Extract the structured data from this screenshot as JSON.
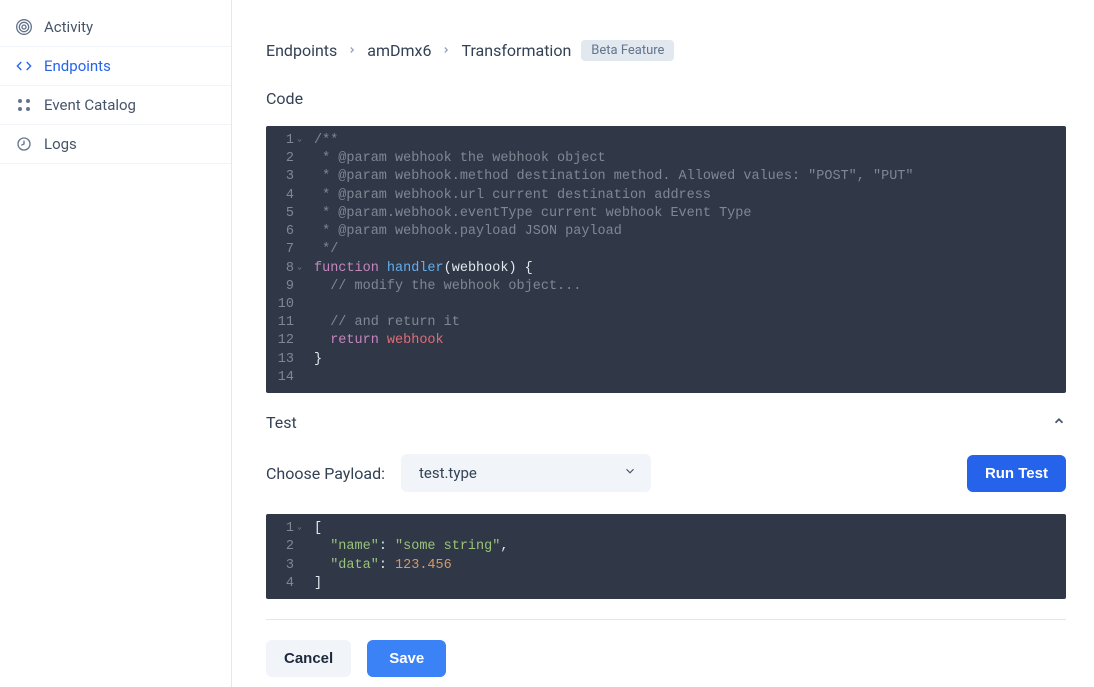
{
  "sidebar": {
    "items": [
      {
        "label": "Activity",
        "icon": "activity-icon",
        "active": false
      },
      {
        "label": "Endpoints",
        "icon": "endpoints-icon",
        "active": true
      },
      {
        "label": "Event Catalog",
        "icon": "catalog-icon",
        "active": false
      },
      {
        "label": "Logs",
        "icon": "logs-icon",
        "active": false
      }
    ]
  },
  "breadcrumb": {
    "items": [
      "Endpoints",
      "amDmx6",
      "Transformation"
    ],
    "badge": "Beta Feature"
  },
  "code_section": {
    "title": "Code",
    "lines": [
      "/**",
      " * @param webhook the webhook object",
      " * @param webhook.method destination method. Allowed values: \"POST\", \"PUT\"",
      " * @param webhook.url current destination address",
      " * @param.webhook.eventType current webhook Event Type",
      " * @param webhook.payload JSON payload",
      " */",
      "function handler(webhook) {",
      "  // modify the webhook object...",
      "",
      "  // and return it",
      "  return webhook",
      "}",
      ""
    ]
  },
  "test_section": {
    "title": "Test",
    "payload_label": "Choose Payload:",
    "payload_selected": "test.type",
    "run_label": "Run Test",
    "lines": [
      "[",
      "  \"name\": \"some string\",",
      "  \"data\": 123.456",
      "]"
    ]
  },
  "footer": {
    "cancel": "Cancel",
    "save": "Save"
  }
}
